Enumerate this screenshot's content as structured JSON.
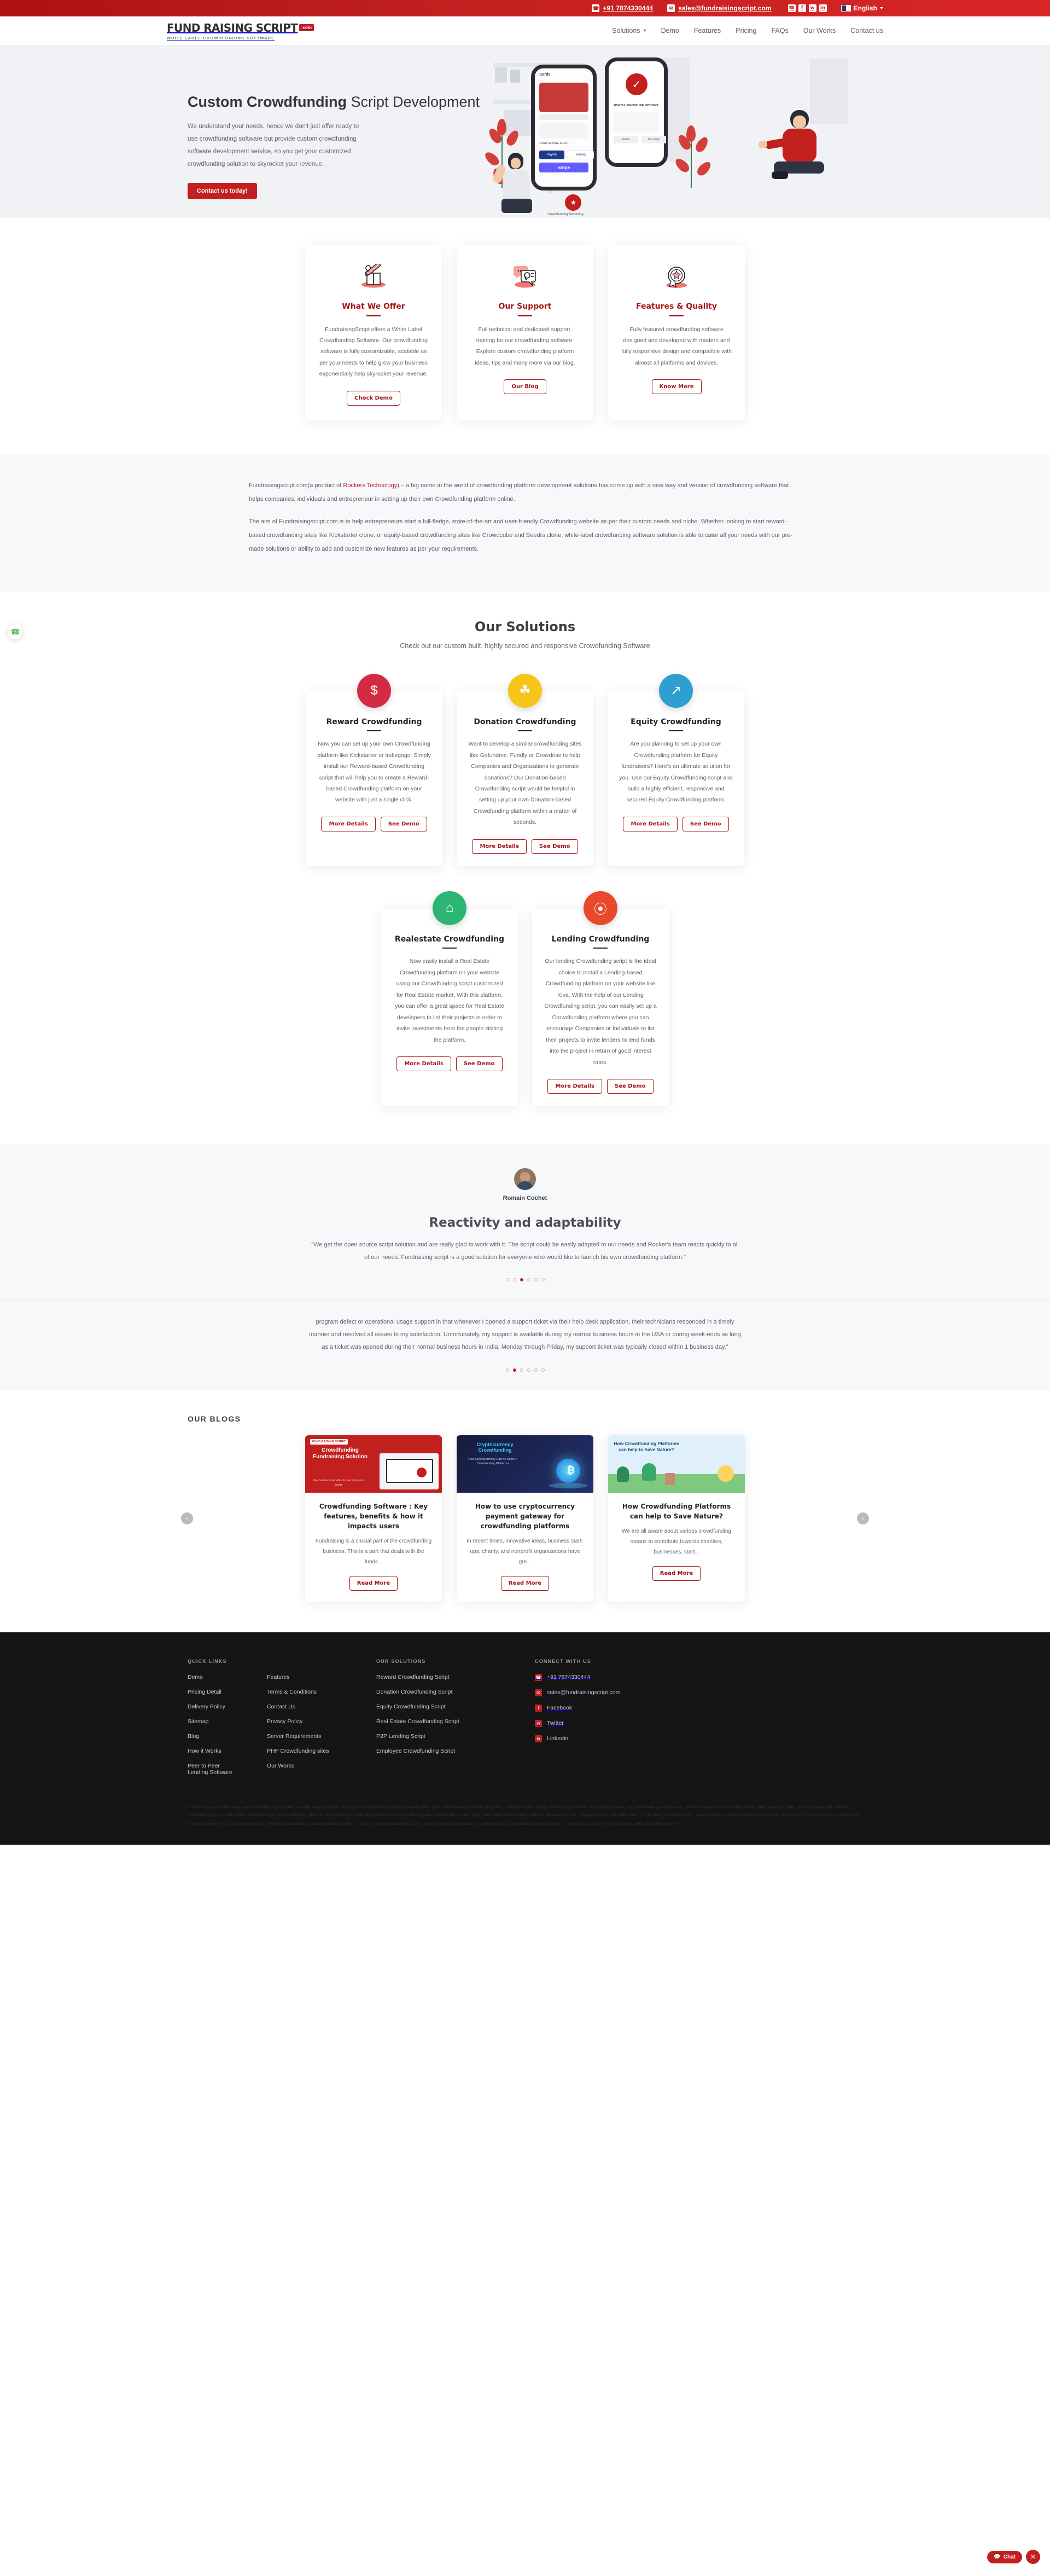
{
  "topbar": {
    "phone": "+91 7874330444",
    "email": "sales@fundraisingscript.com",
    "socials": [
      "whatsapp-icon",
      "facebook-icon",
      "twitter-icon",
      "linkedin-icon"
    ],
    "language": "English"
  },
  "nav": {
    "logo_title": "FUND RAISING SCRIPT",
    "logo_badge": ".com",
    "logo_tagline": "WHITE LABEL CROWDFUNDING SOFTWARE",
    "links": [
      {
        "label": "Solutions",
        "caret": true
      },
      {
        "label": "Demo",
        "caret": false
      },
      {
        "label": "Features",
        "caret": false
      },
      {
        "label": "Pricing",
        "caret": false
      },
      {
        "label": "FAQs",
        "caret": false
      },
      {
        "label": "Our Works",
        "caret": false
      },
      {
        "label": "Contact us",
        "caret": false
      }
    ]
  },
  "hero": {
    "title_bold": "Custom Crowdfunding",
    "title_light": " Script Development",
    "paragraph": "We understand your needs, hence we don't just offer ready to use crowdfunding software but provide custom crowdfunding software development service, so you get your customized crowdfunding solution to skyrocket your revenue.",
    "cta": "Contact us today!",
    "prev_arrow": "‹"
  },
  "cards3": [
    {
      "icon": "gift-box-icon",
      "title": "What We Offer",
      "text": "FundraisingScript offers a White Label Crowdfunding Software. Our crowdfunding software is fully customizable, scalable as per your needs to help grow your business exponentially help skyrocket your revenue.",
      "button": "Check Demo"
    },
    {
      "icon": "support-headset-icon",
      "title": "Our Support",
      "text": "Full technical and dedicated support, training for our crowdfunding software. Explore custom crowdfunding platform ideas, tips and many more via our blog.",
      "button": "Our Blog"
    },
    {
      "icon": "quality-badge-icon",
      "title": "Features & Quality",
      "text": "Fully featured crowdfunding software designed and developed with modern and fully responsive design and compatible with almost all platforms and devices.",
      "button": "Know More"
    }
  ],
  "intro": {
    "p1_a": "Fundraisingscript.com(a product of ",
    "p1_link": "Rockers Technology",
    "p1_b": ") – a big name in the world of crowdfunding platform development solutions has come up with a new way and version of crowdfunding software that helps companies, individuals and entrepreneur in setting up their own Crowdfunding platform online.",
    "p2": "The aim of Fundraisingscript.com is to help entrepreneurs start a full-fledge, state-of-the-art and user-friendly Crowdfunding website as per their custom needs and niche. Whether looking to start reward-based crowdfunding sites like Kickstarter clone, or equity-based crowdfunding sites like Crowdcube and Seedrs clone, white-label crowdfunding software solution is able to cater all your needs with our pre-made solutions or ability to add and customize new features as per your requirements."
  },
  "solutions": {
    "heading": "Our Solutions",
    "subheading": "Check out our custom built, highly secured and responsive Crowdfunding Software",
    "btn_more": "More Details",
    "btn_demo": "See Demo",
    "items": [
      {
        "title": "Reward Crowdfunding",
        "badge_color": "#d42b45",
        "badge_icon": "dollar-hand-icon",
        "glyph": "👍",
        "text": "Now you can set up your own Crowdfunding platform like Kickstarter or Indiegogo. Simply install our Reward-based Crowdfunding script that will help you to create a Reward-based Crowdfunding platform on your website with just a single click."
      },
      {
        "title": "Donation Crowdfunding",
        "badge_color": "#f5c518",
        "badge_icon": "donate-hand-icon",
        "glyph": "👋",
        "text": "Want to develop a similar crowdfunding sites like Gofundme, Fundly or Crowdrise to help Companies and Organizations to generate donations? Our Donation-based Crowdfunding script would be helpful in setting up your own Donation-based Crowdfunding platform within a matter of seconds."
      },
      {
        "title": "Equity Crowdfunding",
        "badge_color": "#2f9fd0",
        "badge_icon": "growth-chart-icon",
        "glyph": "📈",
        "text": "Are you planning to set up your own Crowdfunding platform for Equity fundraisers? Here's an ultimate solution for you. Use our Equity Crowdfunding script and build a highly efficient, responsive and secured Equity Crowdfunding platform."
      },
      {
        "title": "Realestate Crowdfunding",
        "badge_color": "#2bb673",
        "badge_icon": "house-icon",
        "glyph": "🏠",
        "text": "Now easily install a Real Estate Crowdfunding platform on your website using our Crowdfunding script customized for Real Estate market. With this platform, you can offer a great space for Real Estate developers to list their projects in order to invite investments from the people visiting the platform."
      },
      {
        "title": "Lending Crowdfunding",
        "badge_color": "#e8492b",
        "badge_icon": "water-drop-icon",
        "glyph": "💧",
        "text": "Our lending Crowdfunding script is the ideal choice to install a Lending-based Crowdfunding platform on your website like Kiva. With the help of our Lending Crowdfunding script, you can easily set up a Crowdfunding platform where you can encourage Companies or Individuals to list their projects to invite lenders to lend funds into the project in return of good interest rates."
      }
    ]
  },
  "testimonials": [
    {
      "avatar": "user-avatar",
      "name": "Romain Cochet",
      "title": "Reactivity and adaptability",
      "quote": "\"We get the open source script solution and are really glad to work with it. The script could be easily adapted to our needs and Rocker's team reacts quickly to all of our needs. Fundraising script is a good solution for everyone who would like to launch his own crowdfunding platform.\"",
      "dots": 6,
      "active": 2
    },
    {
      "quote": "program defect or operational usage support in that whenever I opened a support ticket via their help desk application, their technicians responded in a timely manner and resolved all issues to my satisfaction. Unfortunately, my support is available during my normal business hours in the USA or during week-ends as long as a ticket was opened during their normal business hours in India, Monday through Friday, my support ticket was typically closed within 1 business day.\"",
      "dots": 6,
      "active": 1
    }
  ],
  "blogs": {
    "heading": "OUR BLOGS",
    "btn": "Read More",
    "prev": "‹",
    "next": "›",
    "items": [
      {
        "image": "crowdfunding-fundraising-solution-thumbnail",
        "img_title": "Crowdfunding Fundraising Solution",
        "img_sub": "Key features, benefits & how it impacts users",
        "title": "Crowdfunding Software : Key features, benefits & how it impacts users",
        "text": "Fundraising is a crucial part of the crowdfunding business. This is a part that deals with the funds..."
      },
      {
        "image": "cryptocurrency-crowdfunding-thumbnail",
        "img_title": "Cryptocurrency Crowdfunding",
        "img_sub": "How Cryptocurrency Can be Used In Crowdfunding Platforms",
        "title": "How to use cryptocurrency payment gateway for crowdfunding platforms",
        "text": "In recent times, innovative ideas, business start-ups, charity, and nonprofit organizations have gre..."
      },
      {
        "image": "crowdfunding-save-nature-thumbnail",
        "img_title": "How Crowdfunding Platforms can help to Save Nature?",
        "img_sub": "",
        "title": "How Crowdfunding Platforms can help to Save Nature?",
        "text": "We are all aware about various crowdfunding means to contribute towards charities, businesses, start..."
      }
    ]
  },
  "footer": {
    "col1_heading": "QUICK LINKS",
    "col1": [
      "Demo",
      "Pricing Detail",
      "Delivery Policy",
      "Sitemap",
      "Blog",
      "How it Works",
      "Peer to Peer Lending Software"
    ],
    "col2": [
      "Features",
      "Terms & Conditions",
      "Contact Us",
      "Privacy Policy",
      "Server Requirements",
      "PHP Crowdfunding sites",
      "Our Works"
    ],
    "col3_heading": "OUR SOLUTIONS",
    "col3": [
      "Reward Crowdfunding Script",
      "Donation Crowdfunding Script",
      "Equity Crowdfunding Script",
      "Real Estate Crowdfunding Script",
      "P2P Lending Script",
      "Employee Crowdfunding Script"
    ],
    "col4_heading": "CONNECT WITH US",
    "col4": [
      {
        "icon": "phone-icon",
        "label": "+91 7874330444"
      },
      {
        "icon": "mail-icon",
        "label": "sales@fundraisingscript.com"
      },
      {
        "icon": "facebook-icon",
        "label": "Facebook"
      },
      {
        "icon": "twitter-icon",
        "label": "Twitter"
      },
      {
        "icon": "linkedin-icon",
        "label": "Linkedin"
      }
    ],
    "seo_text": "Crowdfunding, crowdfunding script, crowdfunding software, crowdfunding site 2022, best source crowdfunding software, crowdfunding video, crowdfunding website template, crowdfunding technology, fundraising software, crowdfunding script php, crowdfunding marketplace, crowdfunding php script, equity crowdfunding script, donation crowdfunding script, reward crowdfunding script, real estate crowdfunding script, crowdfunding platform development, crowdfunding website development company, crowdfunding clone script, white label crowdfunding software, kickstarter clone, indiegogo clone, gofundme clone, fundly clone, crowdrise clone, patreon clone, crowdcube clone, seedrs clone, kiva clone, P2P lending script, peer to peer lending software, equity fundraising platform, lending crowdfunding software, donation platform script, charity crowdfunding script, crowdfunding startup solution, fundraising script, crowdfunding script demo, crowdfunding software price, custom crowdfunding development."
  },
  "widgets": {
    "whatsapp": "whatsapp-icon",
    "chat_label": "Chat",
    "chat_icon": "chat-bubble-icon",
    "close_icon": "✕"
  }
}
